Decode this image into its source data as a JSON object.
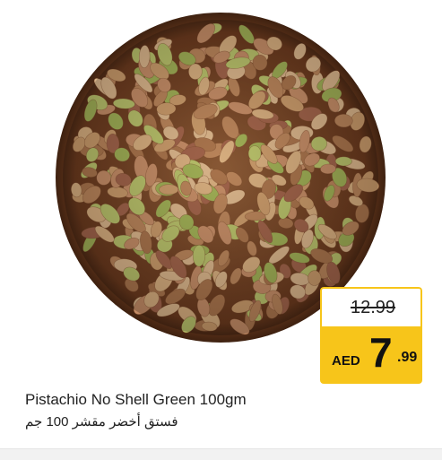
{
  "product": {
    "name_en": "Pistachio No Shell Green 100gm",
    "name_ar": "فستق أخضر مقشر 100 جم",
    "image_icon": "pistachio-bowl-photo"
  },
  "price": {
    "old": "12.99",
    "currency": "AED",
    "integer": "7",
    "decimal": ".99"
  },
  "colors": {
    "price_badge": "#f7c51a",
    "bowl": "#6b3a1e",
    "nut": "#c99a6a"
  }
}
